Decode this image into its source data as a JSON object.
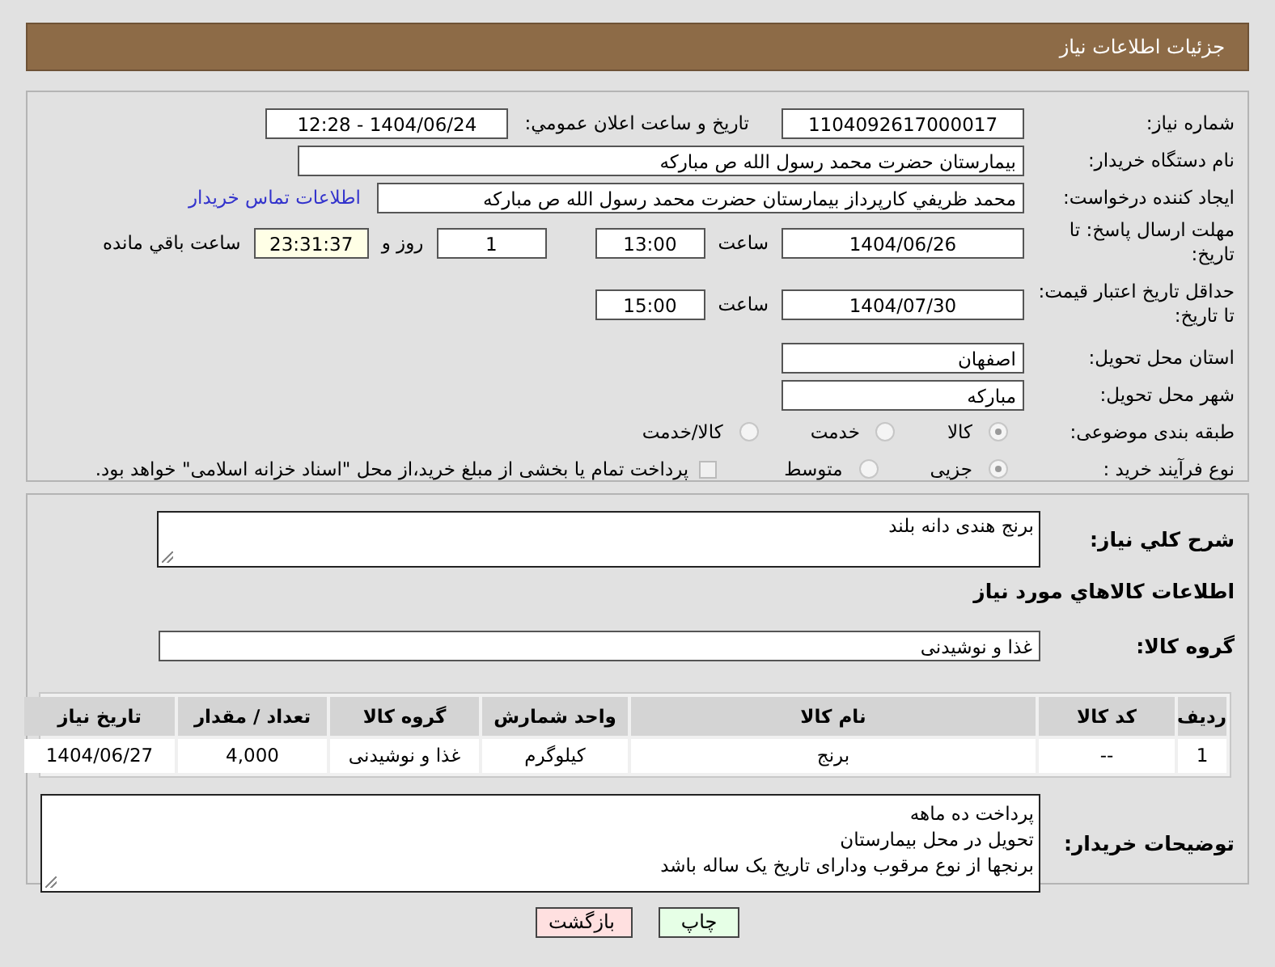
{
  "header": {
    "title": "جزئیات اطلاعات نیاز"
  },
  "need_number": {
    "label": "شماره نیاز:",
    "value": "1104092617000017"
  },
  "announce": {
    "label": "تاريخ و ساعت اعلان عمومي:",
    "value": "1404/06/24 - 12:28"
  },
  "buyer_org": {
    "label": "نام دستگاه خريدار:",
    "value": "بيمارستان حضرت محمد رسول الله  ص  مباركه"
  },
  "creator": {
    "label": "ايجاد کننده درخواست:",
    "value": "محمد ظريفي كارپرداز بيمارستان حضرت محمد رسول الله  ص  مباركه",
    "link": "اطلاعات تماس خريدار"
  },
  "deadline": {
    "label": "مهلت ارسال پاسخ: تا تاريخ:",
    "date": "1404/06/26",
    "time_label": "ساعت",
    "time": "13:00",
    "days": "1",
    "days_label": "روز و",
    "remaining": "23:31:37",
    "remaining_label": "ساعت باقي مانده"
  },
  "validity": {
    "label": "حداقل تاريخ اعتبار قيمت: تا تاريخ:",
    "date": "1404/07/30",
    "time_label": "ساعت",
    "time": "15:00"
  },
  "province": {
    "label": "استان محل تحویل:",
    "value": "اصفهان"
  },
  "city": {
    "label": "شهر محل تحویل:",
    "value": "مبارکه"
  },
  "category": {
    "label": "طبقه بندی موضوعی:",
    "options": [
      {
        "label": "کالا",
        "selected": true
      },
      {
        "label": "خدمت",
        "selected": false
      },
      {
        "label": "کالا/خدمت",
        "selected": false
      }
    ]
  },
  "purchase_type": {
    "label": "نوع فرآیند خرید :",
    "options": [
      {
        "label": "جزیی",
        "selected": true
      },
      {
        "label": "متوسط",
        "selected": false
      }
    ],
    "treasury": {
      "checked": false,
      "text": "پرداخت تمام یا بخشی از مبلغ خرید،از محل \"اسناد خزانه اسلامی\" خواهد بود."
    }
  },
  "description": {
    "label": "شرح کلي نیاز:",
    "value": "برنج هندی دانه بلند"
  },
  "goods_heading": "اطلاعات کالاهاي مورد نیاز",
  "goods_group": {
    "label": "گروه کالا:",
    "value": "غذا و نوشیدنی"
  },
  "table": {
    "columns": [
      "ردیف",
      "کد کالا",
      "نام کالا",
      "واحد شمارش",
      "گروه کالا",
      "تعداد / مقدار",
      "تاریخ نیاز"
    ],
    "rows": [
      [
        "1",
        "--",
        "برنج",
        "کیلوگرم",
        "غذا و نوشیدنی",
        "4,000",
        "1404/06/27"
      ]
    ]
  },
  "notes": {
    "label": "توضیحات خریدار:",
    "lines": [
      "پرداخت ده ماهه",
      "تحویل در محل بیمارستان",
      "برنجها از نوع مرقوب ودارای تاریخ یک ساله باشد"
    ]
  },
  "buttons": [
    {
      "label": "چاپ",
      "kind": "print"
    },
    {
      "label": "بازگشت",
      "kind": "back"
    }
  ]
}
